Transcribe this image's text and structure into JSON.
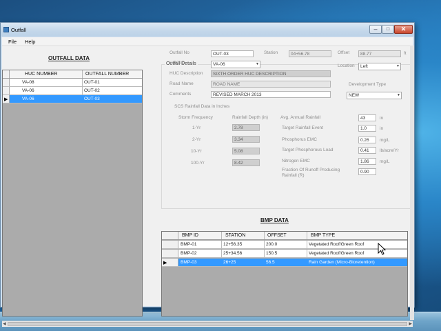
{
  "window": {
    "title": "Outfall",
    "minimize_glyph": "–",
    "maximize_glyph": "□",
    "close_glyph": "✕"
  },
  "menu": {
    "file": "File",
    "help": "Help"
  },
  "outfall_data": {
    "heading": "OUTFALL DATA",
    "columns": [
      "HUC NUMBER",
      "OUTFALL NUMBER"
    ],
    "rows": [
      {
        "huc": "VA-08",
        "outfall": "OUT-01",
        "selected": false
      },
      {
        "huc": "VA-06",
        "outfall": "OUT-02",
        "selected": false
      },
      {
        "huc": "VA-06",
        "outfall": "OUT-03",
        "selected": true
      }
    ],
    "current_row_glyph": "▶"
  },
  "details": {
    "group_title": "Outfall Details",
    "outfall_no_label": "Outfall No",
    "outfall_no": "OUT-03",
    "station_label": "Station",
    "station": "04+56.78",
    "offset_label": "Offset",
    "offset": "88.77",
    "offset_unit": "ft",
    "huc_id_label": "HUC ID",
    "huc_id": "VA-06",
    "location_label": "Location",
    "location": "Left",
    "huc_desc_label": "HUC Description",
    "huc_desc": "SIXTH ORDER HUC DESCRIPTION",
    "road_name_label": "Road Name",
    "road_name": "ROAD NAME",
    "development_type_label": "Development Type",
    "comments_label": "Comments",
    "comments": "REVISED MARCH 2013",
    "development_type": "NEW"
  },
  "scs": {
    "title": "SCS Rainfall Data in Inches",
    "storm_freq_label": "Storm Frequency",
    "rain_depth_label": "Rainfall Depth (in)",
    "storms": [
      {
        "freq": "1-Yr",
        "depth": "2.78"
      },
      {
        "freq": "2-Yr",
        "depth": "3.34"
      },
      {
        "freq": "10-Yr",
        "depth": "5.08"
      },
      {
        "freq": "100-Yr",
        "depth": "8.42"
      }
    ],
    "params": [
      {
        "label": "Avg. Annual Rainfall",
        "value": "43",
        "unit": "in"
      },
      {
        "label": "Target Rainfall Event",
        "value": "1.0",
        "unit": "in"
      },
      {
        "label": "Phosphorus EMC",
        "value": "0.26",
        "unit": "mg/L"
      },
      {
        "label": "Target Phosphorous Load",
        "value": "0.41",
        "unit": "lb/acre/Yr"
      },
      {
        "label": "Nitrogen EMC",
        "value": "1.86",
        "unit": "mg/L"
      },
      {
        "label": "Fraction Of Runoff Producing Rainfall (R)",
        "value": "0.90",
        "unit": ""
      }
    ]
  },
  "bmp_data": {
    "heading": "BMP DATA",
    "columns": [
      "BMP ID",
      "STATION",
      "OFFSET",
      "BMP TYPE"
    ],
    "rows": [
      {
        "id": "BMP-01",
        "station": "12+56.35",
        "offset": "200.0",
        "type": "Vegetated Roof/Green Roof",
        "selected": false
      },
      {
        "id": "BMP-02",
        "station": "25+34.56",
        "offset": "150.5",
        "type": "Vegetated Roof/Green Roof",
        "selected": false
      },
      {
        "id": "BMP-03",
        "station": "26+25",
        "offset": "56.5",
        "type": "Rain Garden (Micro-Bioretention)",
        "selected": true
      }
    ]
  },
  "scroll": {
    "left_arrow": "◀",
    "right_arrow": "▶",
    "grip": "|||"
  },
  "colors": {
    "selection": "#3399ff",
    "grid_background": "#ababab"
  }
}
